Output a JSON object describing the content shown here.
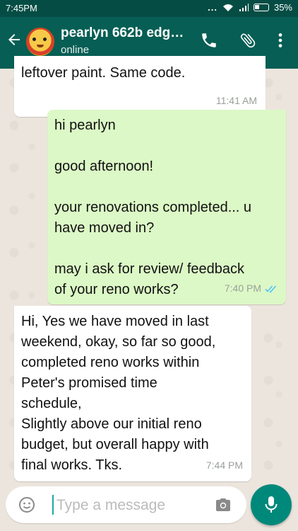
{
  "status_bar": {
    "time": "7:45PM",
    "signal_dots": "...",
    "battery_percent": "35%"
  },
  "header": {
    "contact_name": "pearlyn 662b edg…",
    "contact_status": "online",
    "icons": [
      "back-arrow-icon",
      "phone-icon",
      "paperclip-icon",
      "more-vert-icon"
    ]
  },
  "messages": [
    {
      "direction": "incoming",
      "text": "leftover paint. Same code.",
      "time": "11:41 AM"
    },
    {
      "direction": "outgoing",
      "text": "hi pearlyn\n\ngood afternoon!\n\nyour renovations completed... u\nhave moved in?\n\nmay i ask for review/ feedback\nof your reno works?",
      "time": "7:40 PM",
      "read_receipt": "double-tick-blue"
    },
    {
      "direction": "incoming",
      "text": "Hi, Yes we have moved in last\nweekend, okay, so far so good,\ncompleted reno works within\nPeter's promised time\nschedule,\nSlightly above our initial reno\nbudget, but overall happy with\nfinal works. Tks.",
      "time": "7:44 PM"
    }
  ],
  "composer": {
    "placeholder": "Type a message",
    "value": ""
  },
  "colors": {
    "app_bar": "#075e54",
    "status_bar": "#054d44",
    "outgoing_bubble": "#dcf8c6",
    "incoming_bubble": "#ffffff",
    "fab": "#00897b"
  }
}
